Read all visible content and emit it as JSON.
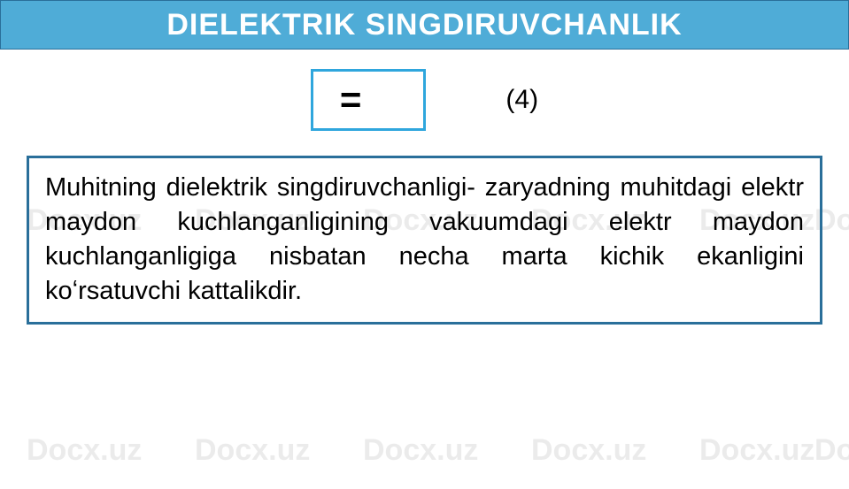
{
  "watermark_text": "Docx.uz",
  "header": {
    "title": "DIELEKTRIK SINGDIRUVCHANLIK"
  },
  "formula": {
    "expression": "=",
    "label": "(4)"
  },
  "definition": {
    "text": "Muhitning dielektrik singdiruvchanligi- zaryadning muhitdagi elektr maydon kuchlanganligining vakuumdagi elektr maydon kuchlanganligiga nisbatan necha marta kichik ekanligini koʻrsatuvchi kattalikdir."
  }
}
